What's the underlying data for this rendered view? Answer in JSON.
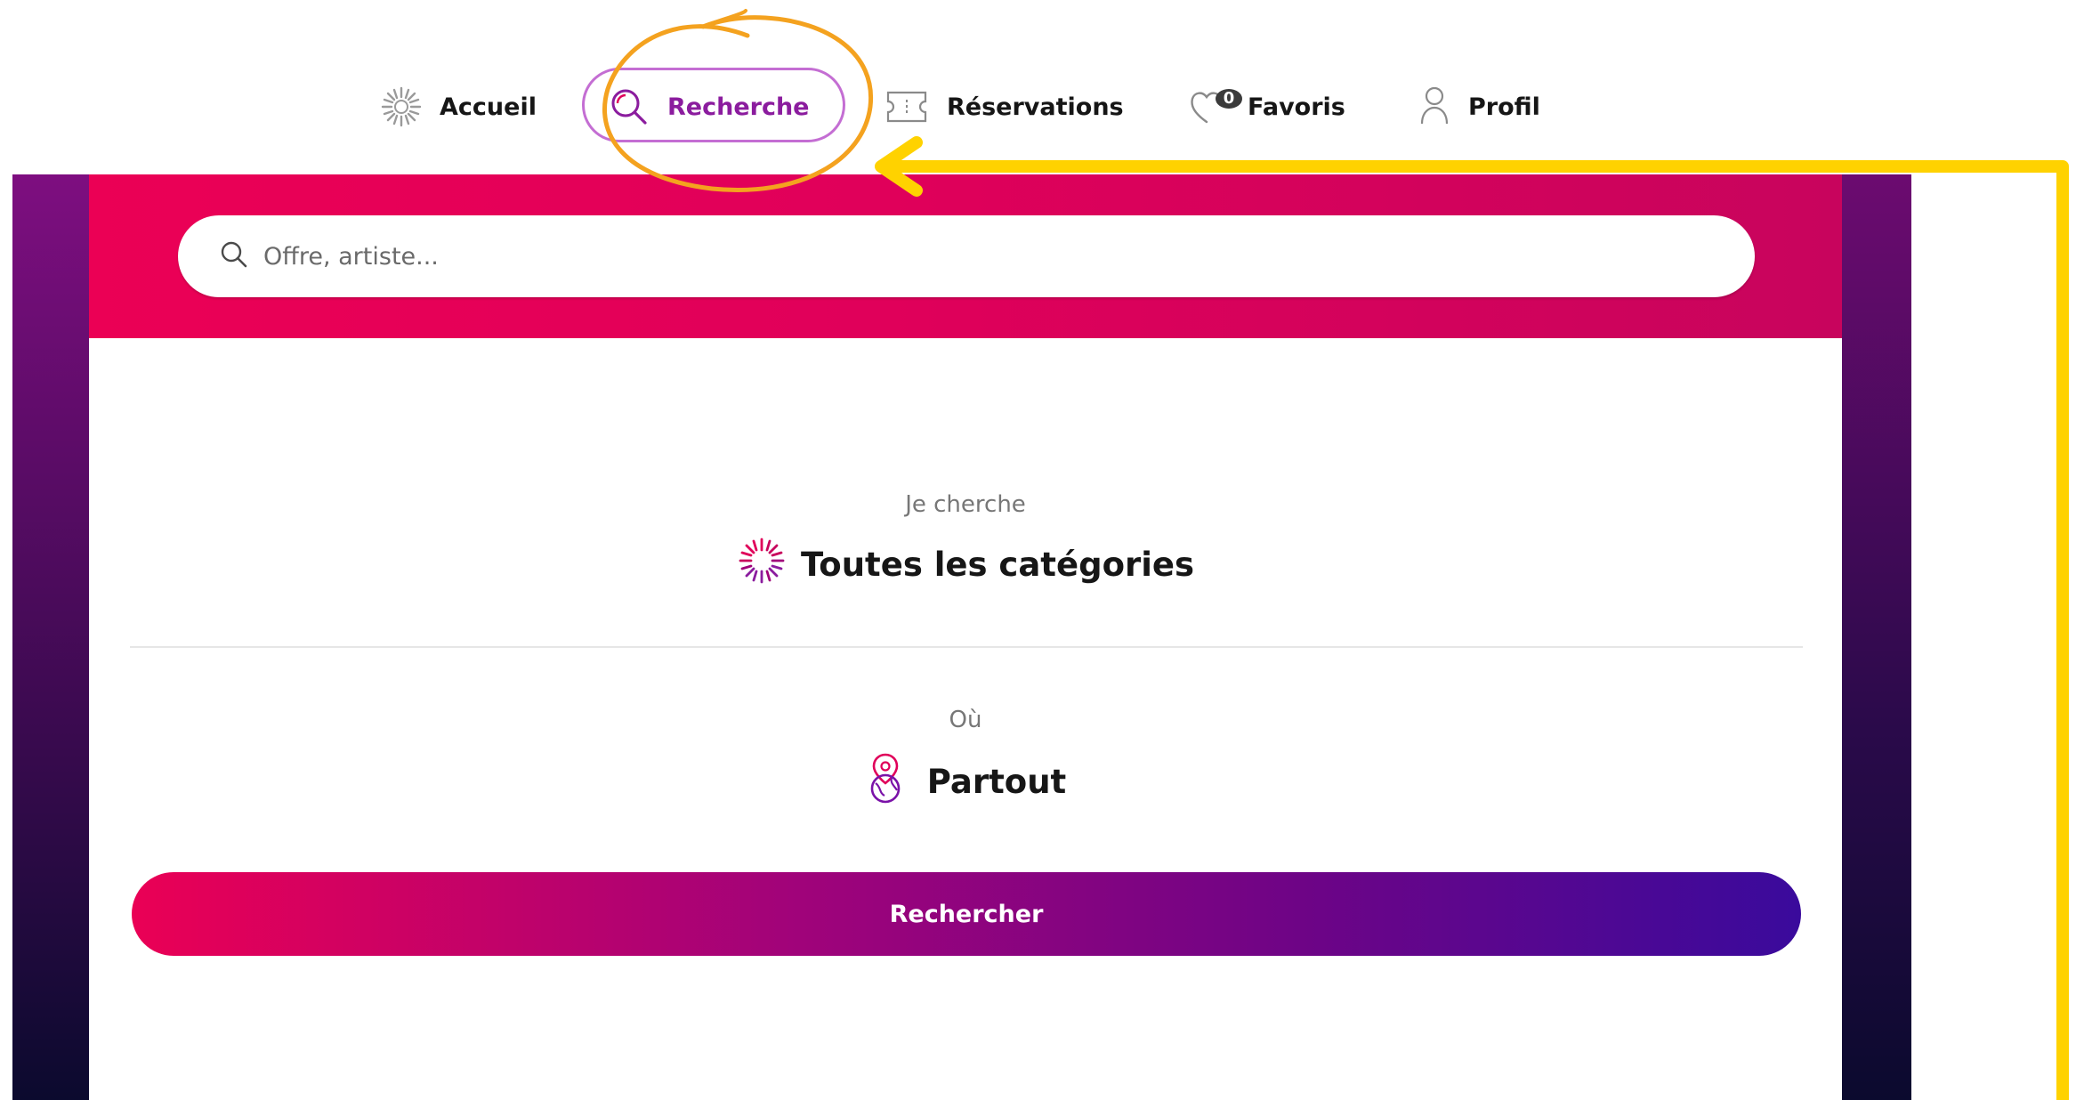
{
  "nav": {
    "items": [
      {
        "label": "Accueil",
        "icon": "sun-burst-icon"
      },
      {
        "label": "Recherche",
        "icon": "search-icon"
      },
      {
        "label": "Réservations",
        "icon": "ticket-icon"
      },
      {
        "label": "Favoris",
        "icon": "heart-icon",
        "badge": "0"
      },
      {
        "label": "Profil",
        "icon": "user-icon"
      }
    ],
    "active": "Recherche"
  },
  "search": {
    "placeholder": "Offre, artiste..."
  },
  "form": {
    "category": {
      "label": "Je cherche",
      "value": "Toutes les catégories",
      "icon": "category-burst-icon"
    },
    "location": {
      "label": "Où",
      "value": "Partout",
      "icon": "location-globe-icon"
    },
    "submit_label": "Rechercher"
  },
  "colors": {
    "brand_pink": "#eb0055",
    "brand_purple": "#8b1c9e",
    "brand_indigo": "#3a0a9c",
    "annotation_orange": "#f4a21f",
    "annotation_yellow": "#ffd200"
  }
}
